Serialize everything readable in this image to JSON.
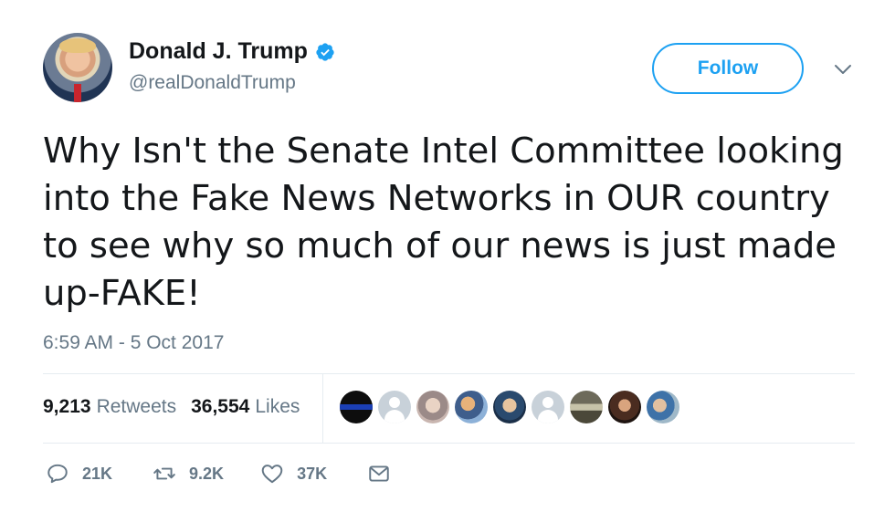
{
  "author": {
    "display_name": "Donald J. Trump",
    "handle": "@realDonaldTrump",
    "verified": true
  },
  "follow_label": "Follow",
  "tweet": {
    "text": "Why Isn't the Senate Intel Committee looking into the Fake News Networks in OUR country to see why so much of our news is just made up-FAKE!",
    "timestamp": "6:59 AM - 5 Oct 2017"
  },
  "stats": {
    "retweets_count": "9,213",
    "retweets_label": "Retweets",
    "likes_count": "36,554",
    "likes_label": "Likes"
  },
  "actions": {
    "reply_count": "21K",
    "retweet_count": "9.2K",
    "like_count": "37K"
  },
  "colors": {
    "accent": "#1da1f2",
    "secondary_text": "#657786",
    "primary_text": "#14171a",
    "divider": "#e6ecf0"
  },
  "icons": [
    "verified-badge-icon",
    "chevron-down-icon",
    "reply-icon",
    "retweet-icon",
    "like-icon",
    "message-icon"
  ]
}
